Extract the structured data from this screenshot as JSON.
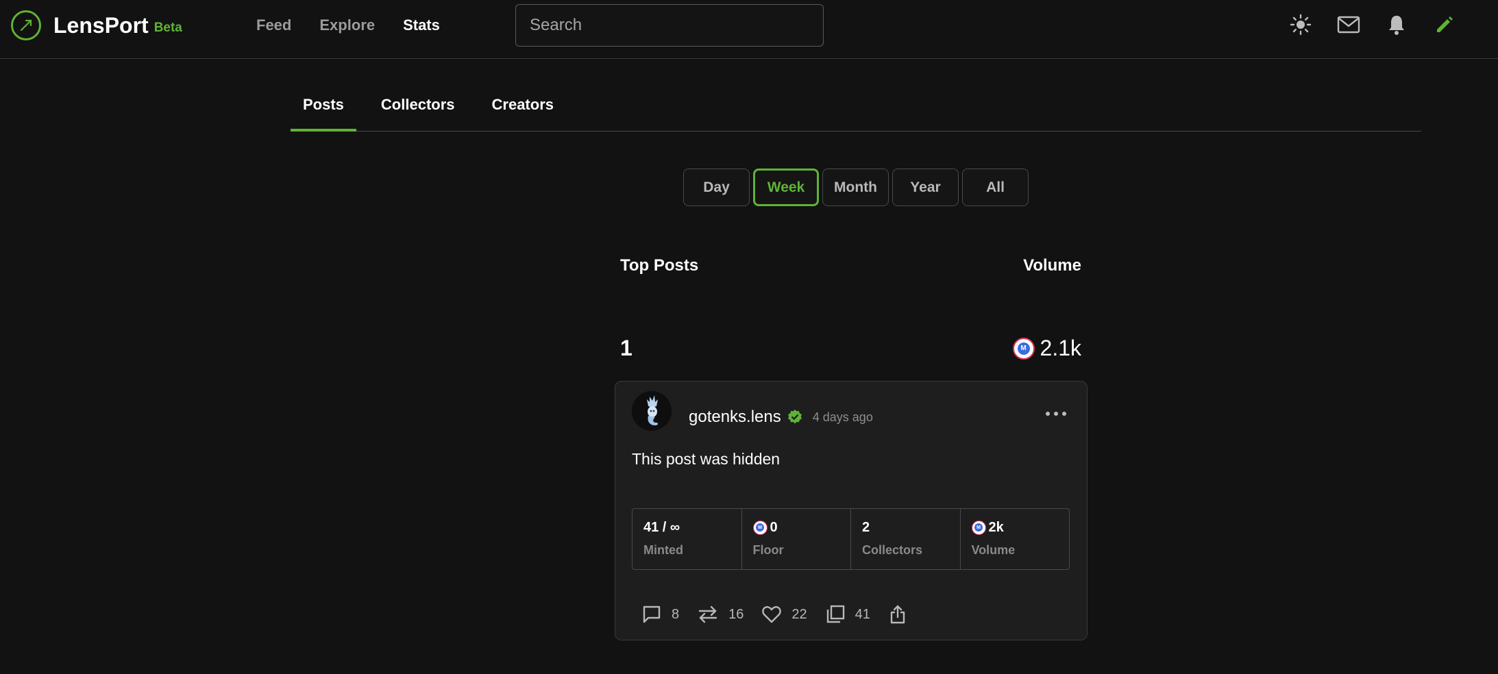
{
  "brand": {
    "name": "LensPort",
    "badge": "Beta",
    "accent": "#5fb336"
  },
  "nav": {
    "items": [
      "Feed",
      "Explore",
      "Stats"
    ],
    "active": "Stats"
  },
  "search": {
    "placeholder": "Search",
    "value": ""
  },
  "top_icons": [
    "sun-icon",
    "mail-icon",
    "bell-icon",
    "pencil-icon"
  ],
  "tabs": {
    "items": [
      "Posts",
      "Collectors",
      "Creators"
    ],
    "active": "Posts"
  },
  "filters": {
    "items": [
      "Day",
      "Week",
      "Month",
      "Year",
      "All"
    ],
    "active": "Week"
  },
  "list": {
    "left_header": "Top Posts",
    "right_header": "Volume",
    "entries": [
      {
        "rank": "1",
        "volume": "2.1k",
        "post": {
          "author": "gotenks.lens",
          "verified": true,
          "time": "4 days ago",
          "text": "This post was hidden",
          "stats": [
            {
              "value": "41 / ∞",
              "label": "Minted",
              "token": false
            },
            {
              "value": "0",
              "label": "Floor",
              "token": true
            },
            {
              "value": "2",
              "label": "Collectors",
              "token": false
            },
            {
              "value": "2k",
              "label": "Volume",
              "token": true
            }
          ],
          "actions": {
            "comments": "8",
            "mirrors": "16",
            "likes": "22",
            "collects": "41"
          }
        }
      }
    ]
  }
}
